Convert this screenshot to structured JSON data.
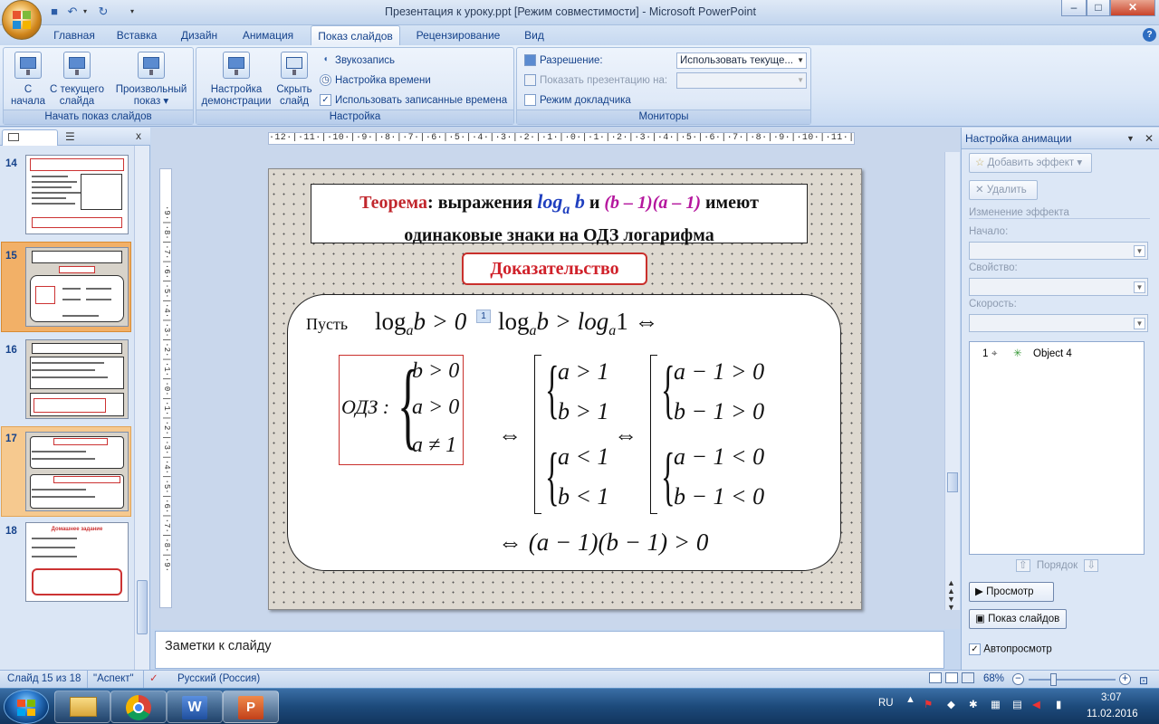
{
  "window": {
    "title": "Презентация к уроку.ppt [Режим совместимости] - Microsoft PowerPoint",
    "controls": {
      "minimize": "–",
      "maximize": "□",
      "close": "✕"
    }
  },
  "qat": {
    "save_icon": "save-icon",
    "undo_icon": "undo-icon",
    "redo_icon": "redo-icon"
  },
  "tabs": [
    "Главная",
    "Вставка",
    "Дизайн",
    "Анимация",
    "Показ слайдов",
    "Рецензирование",
    "Вид"
  ],
  "active_tab": "Показ слайдов",
  "ribbon": {
    "group_start": {
      "label": "Начать показ слайдов",
      "from_start": "С\nначала",
      "from_start_l1": "С",
      "from_start_l2": "начала",
      "from_current_l1": "С текущего",
      "from_current_l2": "слайда",
      "custom_l1": "Произвольный",
      "custom_l2": "показ ▾"
    },
    "group_setup": {
      "label": "Настройка",
      "setup_l1": "Настройка",
      "setup_l2": "демонстрации",
      "hide_l1": "Скрыть",
      "hide_l2": "слайд",
      "record": "Звукозапись",
      "rehearse": "Настройка времени",
      "use_timings": "Использовать записанные времена",
      "use_timings_checked": "✓"
    },
    "group_monitors": {
      "label": "Мониторы",
      "resolution_label": "Разрешение:",
      "resolution_value": "Использовать текуще...",
      "show_on_label": "Показать презентацию на:",
      "show_on_value": "",
      "presenter_view": "Режим докладчика"
    }
  },
  "left_panel": {
    "tab_slides_icon": "slides-icon",
    "tab_outline_icon": "outline-icon",
    "close": "x",
    "thumbs": [
      {
        "num": "14"
      },
      {
        "num": "15"
      },
      {
        "num": "16"
      },
      {
        "num": "17"
      },
      {
        "num": "18",
        "title": "Домашнее задание"
      }
    ]
  },
  "ruler": {
    "h": "·12·|·11·|·10·|·9·|·8·|·7·|·6·|·5·|·4·|·3·|·2·|·1·|·0·|·1·|·2·|·3·|·4·|·5·|·6·|·7·|·8·|·9·|·10·|·11·|·12·",
    "v": "·9·|·8·|·7·|·6·|·5·|·4·|·3·|·2·|·1·|·0·|·1·|·2·|·3·|·4·|·5·|·6·|·7·|·8·|·9·"
  },
  "slide": {
    "theorem_word": "Теорема",
    "theorem_rest1": ": выражения ",
    "log_a_b": "log",
    "log_sub": "a",
    "log_arg": " b",
    "and": " и ",
    "product": "(b – 1)(a – 1)",
    "have": " имеют",
    "line2": "одинаковые знаки на ОДЗ логарифма",
    "proof": "Доказательство",
    "let": "Пусть",
    "cond1": "log",
    "cond1_sub": "a",
    "cond1_rest": "b > 0",
    "badge": "1",
    "cond2_a": "log",
    "cond2_sub": "a",
    "cond2_b": "b > log",
    "cond2_sub2": "a",
    "cond2_c": "1 ⇔",
    "odz": "ОДЗ :",
    "odz_1": "b > 0",
    "odz_2": "a > 0",
    "odz_3": "a ≠ 1",
    "equiv": "⇔",
    "sys1_1": "a > 1",
    "sys1_2": "b > 1",
    "sys2_1": "a < 1",
    "sys2_2": "b < 1",
    "sys3_1": "a − 1 > 0",
    "sys3_2": "b − 1 > 0",
    "sys4_1": "a − 1 < 0",
    "sys4_2": "b − 1 < 0",
    "final": "⇔ (a − 1)(b − 1) > 0",
    "colors": {
      "red": "#c1272d",
      "blue": "#1f3fbf",
      "magenta": "#b5179e"
    }
  },
  "anim_pane": {
    "title": "Настройка анимации",
    "add_effect": "Добавить эффект",
    "remove": "Удалить",
    "change_effect": "Изменение эффекта",
    "start": "Начало:",
    "property": "Свойство:",
    "speed": "Скорость:",
    "item_num": "1",
    "item_name": "Object 4",
    "order": "Порядок",
    "preview": "Просмотр",
    "slideshow": "Показ слайдов",
    "autopreview": "Автопросмотр",
    "autopreview_checked": "✓"
  },
  "notes": {
    "placeholder": "Заметки к слайду"
  },
  "status": {
    "slide_of": "Слайд 15 из 18",
    "theme": "\"Аспект\"",
    "language": "Русский (Россия)",
    "zoom": "68%"
  },
  "taskbar": {
    "lang": "RU",
    "time": "3:07",
    "date": "11.02.2016"
  }
}
